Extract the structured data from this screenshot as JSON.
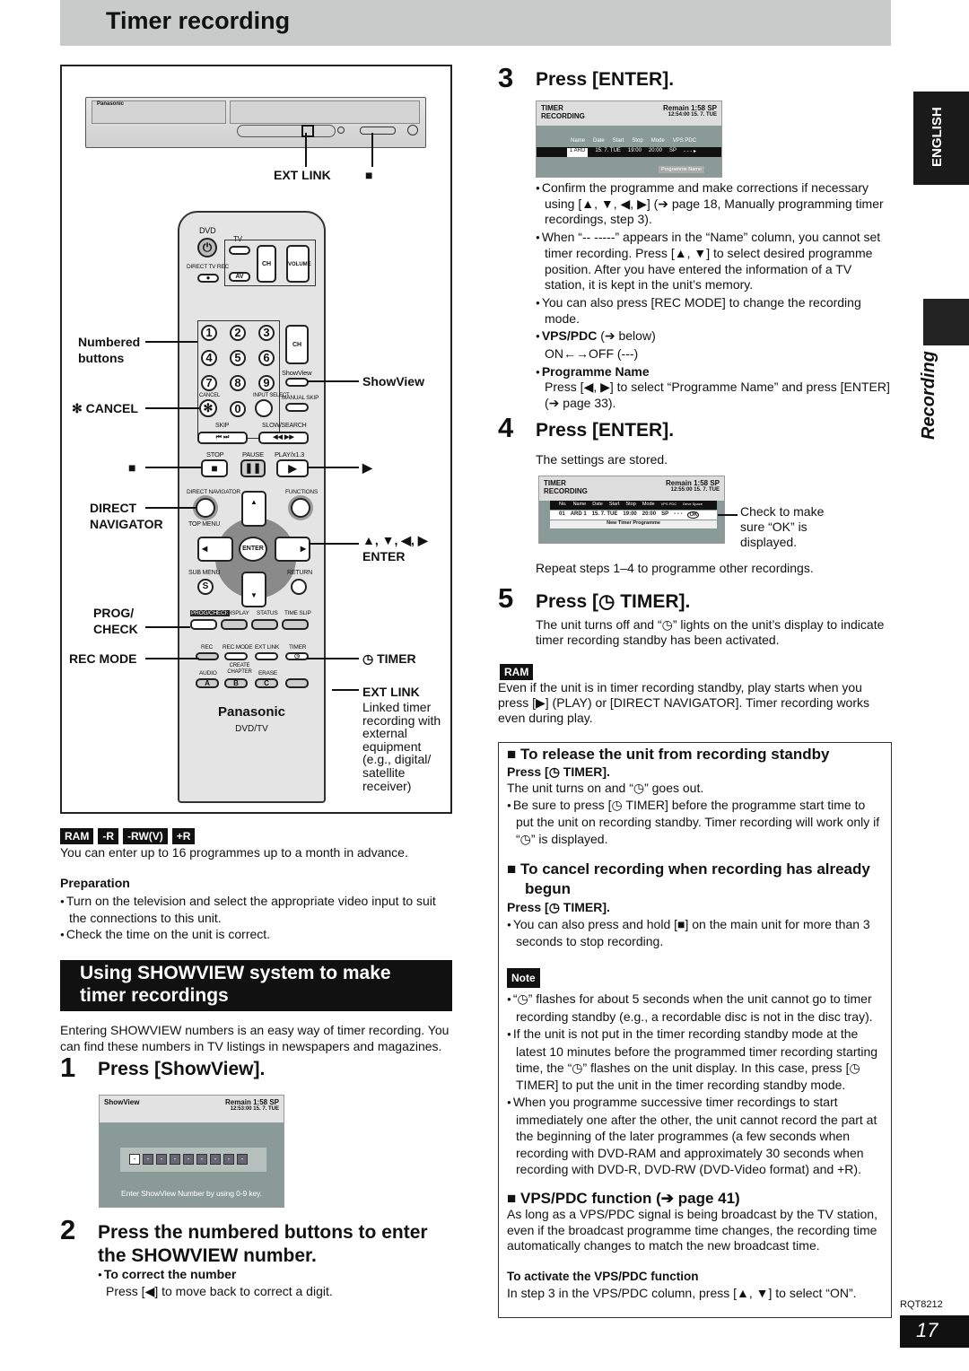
{
  "header": {
    "title": "Timer recording"
  },
  "sidebar": {
    "language_tab": "ENGLISH",
    "section_label": "Recording"
  },
  "illustration": {
    "device_brand": "Panasonic",
    "device_labels": {
      "ext_link": "EXT LINK",
      "stop": "■"
    },
    "remote": {
      "dvd": "DVD",
      "tv": "TV",
      "direct_tv_rec": "DIRECT TV REC",
      "av": "AV",
      "ch": "CH",
      "volume": "VOLUME",
      "digits": [
        "1",
        "2",
        "3",
        "4",
        "5",
        "6",
        "7",
        "8",
        "9",
        "0"
      ],
      "cancel": "CANCEL",
      "input_select": "INPUT SELECT",
      "showview": "ShowView",
      "manual_skip": "MANUAL SKIP",
      "skip": "SKIP",
      "slow_search": "SLOW/SEARCH",
      "stop": "STOP",
      "pause": "PAUSE",
      "play": "PLAY/x1.3",
      "direct_navigator": "DIRECT NAVIGATOR",
      "functions": "FUNCTIONS",
      "top_menu": "TOP MENU",
      "enter": "ENTER",
      "sub_menu": "SUB MENU",
      "return": "RETURN",
      "s": "S",
      "prog_check": "PROG/CHECK",
      "display": "DISPLAY",
      "status": "STATUS",
      "time_slip": "TIME SLIP",
      "rec": "REC",
      "rec_mode": "REC MODE",
      "ext_link": "EXT LINK",
      "timer": "TIMER",
      "audio": "AUDIO",
      "create_chapter": "CREATE CHAPTER",
      "erase": "ERASE",
      "a": "A",
      "b": "B",
      "c": "C",
      "brand": "Panasonic",
      "model": "DVD/TV"
    },
    "callouts_left": {
      "numbered": "Numbered buttons",
      "cancel": "✻ CANCEL",
      "stop": "■",
      "direct_nav": "DIRECT NAVIGATOR",
      "prog_check": "PROG/ CHECK",
      "rec_mode": "REC MODE"
    },
    "callouts_right": {
      "showview": "ShowView",
      "play": "▶",
      "arrows": "▲, ▼, ◀, ▶",
      "enter": "ENTER",
      "timer": "◷ TIMER",
      "ext_link": "EXT LINK",
      "ext_link_desc": "Linked timer recording with external equipment (e.g., digital/ satellite receiver)"
    }
  },
  "left": {
    "badges": [
      "RAM",
      "-R",
      "-RW(V)",
      "+R"
    ],
    "intro": "You can enter up to 16 programmes up to a month in advance.",
    "preparation_title": "Preparation",
    "preparation": [
      "Turn on the television and select the appropriate video input to suit the connections to this unit.",
      "Check the time on the unit is correct."
    ],
    "section_title": "Using SHOWVIEW system to make timer recordings",
    "section_intro": "Entering SHOWVIEW numbers is an easy way of timer recording. You can find these numbers in TV listings in newspapers and magazines.",
    "step1": {
      "num": "1",
      "title": "Press [ShowView]."
    },
    "showview_screen": {
      "title": "ShowView",
      "remain": "Remain   1:58  SP",
      "time": "12:53:00   15. 7.  TUE",
      "digits": [
        "-",
        "-",
        "-",
        "-",
        "-",
        "-",
        "-",
        "-",
        "-"
      ],
      "hint": "Enter ShowView Number by using 0-9 key."
    },
    "step2": {
      "num": "2",
      "title": "Press the numbered buttons to enter the SHOWVIEW number.",
      "sub_title": "To correct the number",
      "sub_text": "Press [◀] to move back to correct a digit."
    }
  },
  "right": {
    "step3": {
      "num": "3",
      "title": "Press [ENTER]."
    },
    "screen3": {
      "title1": "TIMER",
      "title2": "RECORDING",
      "remain": "Remain   1:58  SP",
      "time": "12:54:00   15. 7.  TUE",
      "cols": [
        "Name",
        "Date",
        "Start",
        "Stop",
        "Mode",
        "VPS PDC"
      ],
      "row": [
        "1  ARD",
        "15. 7. TUE",
        "19:00",
        "20:00",
        "SP",
        "- - -  ▸"
      ],
      "button": "Programme Name"
    },
    "step3_bullets": [
      "Confirm the programme and make corrections if necessary using [▲, ▼, ◀, ▶] (➔ page 18, Manually programming timer recordings, step 3).",
      "When “-- -----” appears in the “Name” column, you cannot set timer recording. Press [▲, ▼] to select desired programme position. After you have entered the information of a TV station, it is kept in the unit’s memory.",
      "You can also press [REC MODE] to change the recording mode."
    ],
    "vps_title": "VPS/PDC",
    "vps_ref": " (➔ below)",
    "vps_values": "ON←→OFF (---)",
    "progname_title": "Programme Name",
    "progname_text": "Press [◀, ▶] to select “Programme Name” and press [ENTER] (➔ page 33).",
    "step4": {
      "num": "4",
      "title": "Press [ENTER].",
      "text": "The settings are stored."
    },
    "screen4": {
      "title1": "TIMER",
      "title2": "RECORDING",
      "remain": "Remain   1:58  SP",
      "time": "12:55:00   15. 7.  TUE",
      "cols": [
        "No.",
        "Name",
        "Date",
        "Start",
        "Stop",
        "Mode",
        "VPS PDC",
        "Drive Space"
      ],
      "row": [
        "01",
        "ARD 1",
        "15. 7. TUE",
        "19:00",
        "20:00",
        "SP",
        "- - -",
        "OK"
      ],
      "new": "New Timer Programme"
    },
    "check_note": "Check to make sure “OK” is displayed.",
    "repeat": "Repeat steps 1–4 to programme other recordings.",
    "step5": {
      "num": "5",
      "title": "Press [◷ TIMER].",
      "text": "The unit turns off and “◷” lights on the unit’s display to indicate timer recording standby has been activated."
    },
    "ram_badge": "RAM",
    "ram_text": "Even if the unit is in timer recording standby, play starts when you press [▶] (PLAY) or [DIRECT NAVIGATOR]. Timer recording works even during play.",
    "box": {
      "release_title": "To release the unit from recording standby",
      "release_press": "Press [◷ TIMER].",
      "release_text": "The unit turns on and “◷” goes out.",
      "release_bullet": "Be sure to press [◷ TIMER] before the programme start time to put the unit on recording standby. Timer recording will work only if “◷” is displayed.",
      "cancel_title": "To cancel recording when recording has already begun",
      "cancel_press": "Press [◷ TIMER].",
      "cancel_bullet": "You can also press and hold [■] on the main unit for more than 3 seconds to stop recording.",
      "note_label": "Note",
      "notes": [
        "“◷” flashes for about 5 seconds when the unit cannot go to timer recording standby (e.g., a recordable disc is not in the disc tray).",
        "If the unit is not put in the timer recording standby mode at the latest 10 minutes before the programmed timer recording starting time, the “◷” flashes on the unit display. In this case, press [◷ TIMER] to put the unit in the timer recording standby mode.",
        "When you programme successive timer recordings to start immediately one after the other, the unit cannot record the part at the beginning of the later programmes (a few seconds when recording with DVD-RAM and approximately 30 seconds when recording with DVD-R, DVD-RW (DVD-Video format) and +R)."
      ],
      "vps_title": "VPS/PDC function (➔ page 41)",
      "vps_text": "As long as a VPS/PDC signal is being broadcast by the TV station, even if the broadcast programme time changes, the recording time automatically changes to match the new broadcast time.",
      "activate_title": "To activate the VPS/PDC function",
      "activate_text": "In step 3 in the VPS/PDC column, press [▲, ▼] to select “ON”."
    }
  },
  "footer": {
    "code": "RQT8212",
    "page": "17"
  }
}
